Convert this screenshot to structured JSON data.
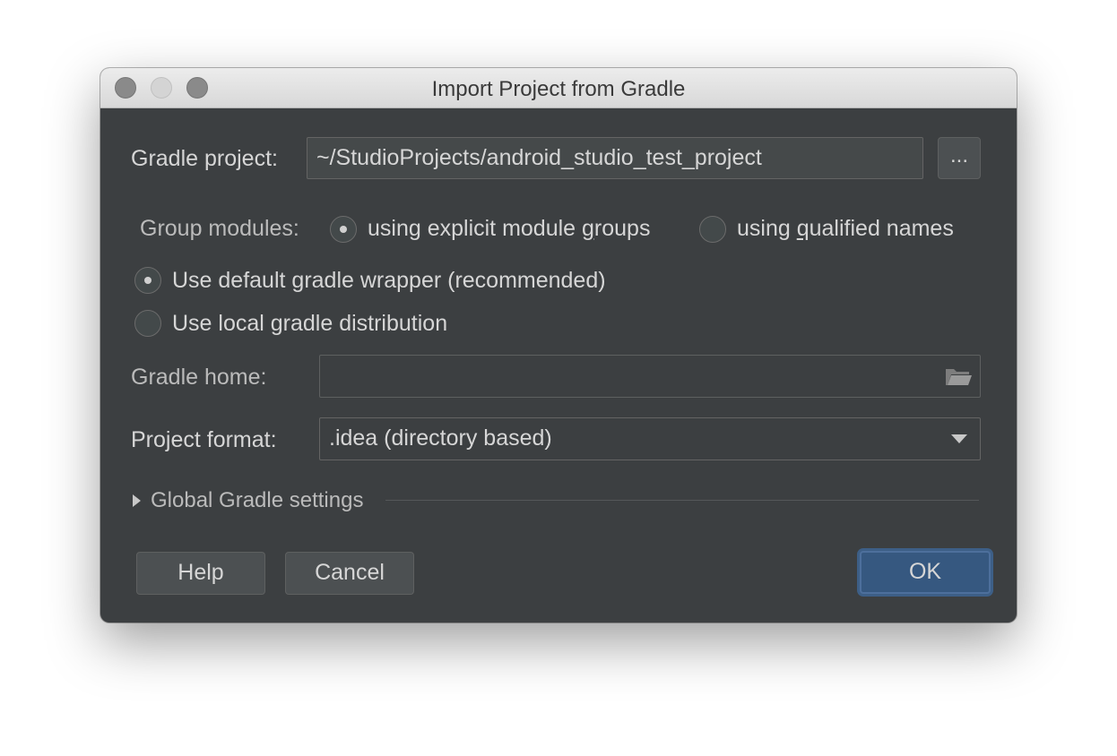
{
  "window": {
    "title": "Import Project from Gradle"
  },
  "gradle_project": {
    "label": "Gradle project:",
    "value": "~/StudioProjects/android_studio_test_project",
    "browse_label": "..."
  },
  "group_modules": {
    "label": "Group modules:",
    "option1": {
      "label_before": "using explicit module ",
      "label_ul": "g",
      "label_after": "roups",
      "selected": true
    },
    "option2": {
      "label_before": "using ",
      "label_ul": "q",
      "label_after": "ualified names",
      "selected": false
    }
  },
  "wrapper": {
    "default_label": "Use default gradle wrapper (recommended)",
    "default_selected": true,
    "local_label": "Use local gradle distribution",
    "local_selected": false
  },
  "gradle_home": {
    "label": "Gradle home:",
    "value": ""
  },
  "project_format": {
    "label": "Project format:",
    "value": ".idea (directory based)"
  },
  "global_settings": {
    "label": "Global Gradle settings"
  },
  "buttons": {
    "help": "Help",
    "cancel": "Cancel",
    "ok": "OK"
  },
  "colors": {
    "dialog_bg": "#3c3f41",
    "primary_button": "#365880",
    "text": "#d6d6d6"
  },
  "icons": [
    "close-icon",
    "minimize-icon",
    "zoom-icon",
    "folder-icon",
    "chevron-down-icon",
    "triangle-right-icon"
  ]
}
